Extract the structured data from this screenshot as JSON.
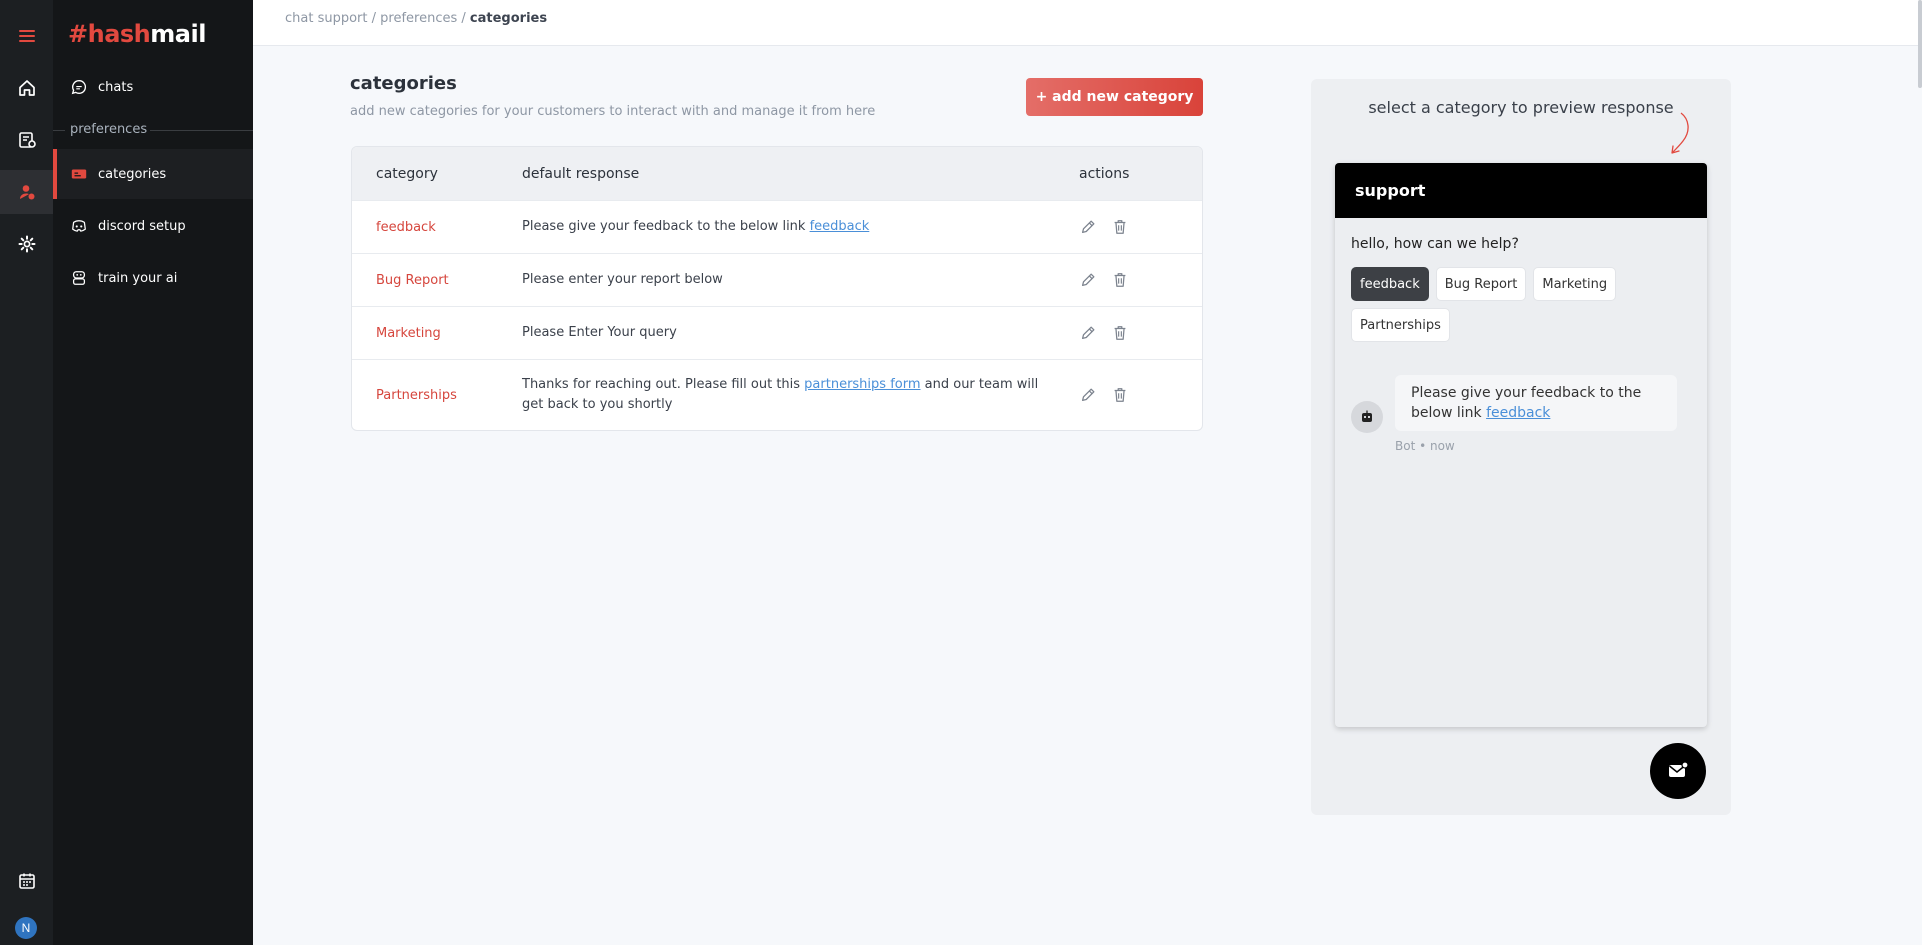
{
  "brand": {
    "hash": "#hash",
    "mail": "mail"
  },
  "sidebar": {
    "chats": "chats",
    "section": "preferences",
    "items": [
      {
        "label": "categories"
      },
      {
        "label": "discord setup"
      },
      {
        "label": "train your ai"
      }
    ]
  },
  "breadcrumb": {
    "part1": "chat support",
    "sep": " / ",
    "part2": "preferences",
    "current": "categories"
  },
  "page": {
    "title": "categories",
    "subtitle": "add new categories for your customers to interact with and manage it from here",
    "add_button": "+ add new category"
  },
  "table": {
    "headers": {
      "category": "category",
      "response": "default response",
      "actions": "actions"
    },
    "rows": [
      {
        "category": "feedback",
        "response_pre": "Please give your feedback to the below link ",
        "link": "feedback",
        "response_post": ""
      },
      {
        "category": "Bug Report",
        "response_pre": "Please enter your report below",
        "link": "",
        "response_post": ""
      },
      {
        "category": "Marketing",
        "response_pre": "Please Enter Your query",
        "link": "",
        "response_post": ""
      },
      {
        "category": "Partnerships",
        "response_pre": "Thanks for reaching out. Please fill out this ",
        "link": "partnerships form",
        "response_post": " and our team will get back to you shortly"
      }
    ]
  },
  "preview": {
    "title": "select a category to preview response",
    "widget_title": "support",
    "greeting": "hello, how can we help?",
    "chips": [
      "feedback",
      "Bug Report",
      "Marketing",
      "Partnerships"
    ],
    "selected_chip": "feedback",
    "message_pre": "Please give your feedback to the below link ",
    "message_link": "feedback",
    "meta": "Bot • now"
  },
  "user": {
    "initial": "N"
  },
  "colors": {
    "accent": "#e2493f",
    "link": "#4a8fd8",
    "rail": "#1c1f22",
    "sidebar": "#141618"
  },
  "icons": [
    "menu-icon",
    "home-icon",
    "inbox-icon",
    "users-icon",
    "gear-icon",
    "calendar-icon",
    "chat-bubble-icon",
    "tag-icon",
    "discord-icon",
    "ai-icon",
    "edit-icon",
    "trash-icon",
    "bot-icon",
    "mail-icon",
    "curved-arrow-icon"
  ]
}
